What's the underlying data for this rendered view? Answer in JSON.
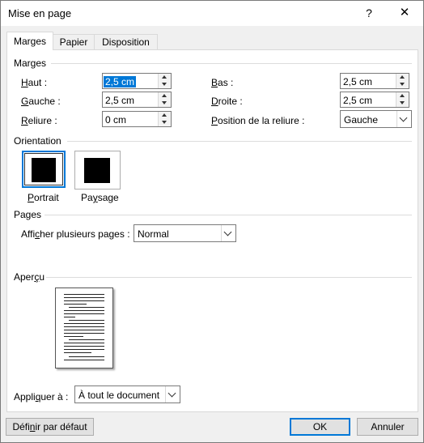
{
  "window": {
    "title": "Mise en page",
    "help_glyph": "?",
    "close_glyph": "✕"
  },
  "tabs": [
    {
      "label": "Marges",
      "active": true
    },
    {
      "label": "Papier",
      "active": false
    },
    {
      "label": "Disposition",
      "active": false
    }
  ],
  "margins": {
    "group_label": "Marges",
    "top": {
      "label_key": "H",
      "label_rest": "aut :",
      "value": "2,5 cm"
    },
    "bottom": {
      "label_key": "B",
      "label_rest": "as :",
      "value": "2,5 cm"
    },
    "left": {
      "label_key": "G",
      "label_rest": "auche :",
      "value": "2,5 cm"
    },
    "right": {
      "label_key": "D",
      "label_rest": "roite :",
      "value": "2,5 cm"
    },
    "gutter": {
      "label_key": "R",
      "label_rest": "eliure :",
      "value": "0 cm"
    },
    "gutter_position": {
      "label_key": "P",
      "label_rest": "osition de la reliure :",
      "value": "Gauche"
    }
  },
  "orientation": {
    "group_label": "Orientation",
    "portrait": {
      "label_key": "P",
      "label_rest": "ortrait",
      "selected": true
    },
    "landscape": {
      "label_pre": "Pa",
      "label_key": "y",
      "label_rest": "sage",
      "selected": false
    }
  },
  "pages": {
    "group_label": "Pages",
    "multiple_pages": {
      "label_pre": "Affi",
      "label_key": "c",
      "label_rest": "her plusieurs pages :",
      "value": "Normal"
    }
  },
  "preview": {
    "group_label_pre": "Aper",
    "group_label_key": "ç",
    "group_label_rest": "u"
  },
  "apply_to": {
    "label_pre": "Appli",
    "label_key": "q",
    "label_rest": "uer à :",
    "value": "À tout le document"
  },
  "footer": {
    "set_default_pre": "Défi",
    "set_default_key": "n",
    "set_default_rest": "ir par défaut",
    "ok_label": "OK",
    "cancel_label": "Annuler"
  },
  "colors": {
    "accent": "#0078d7",
    "selection": "#0078d7",
    "dialog_bg": "#f0f0f0",
    "panel_bg": "#ffffff"
  },
  "icons": {
    "help": "question-mark-icon",
    "close": "close-icon",
    "spinner_up": "triangle-up-icon",
    "spinner_down": "triangle-down-icon",
    "dropdown": "chevron-down-icon"
  }
}
